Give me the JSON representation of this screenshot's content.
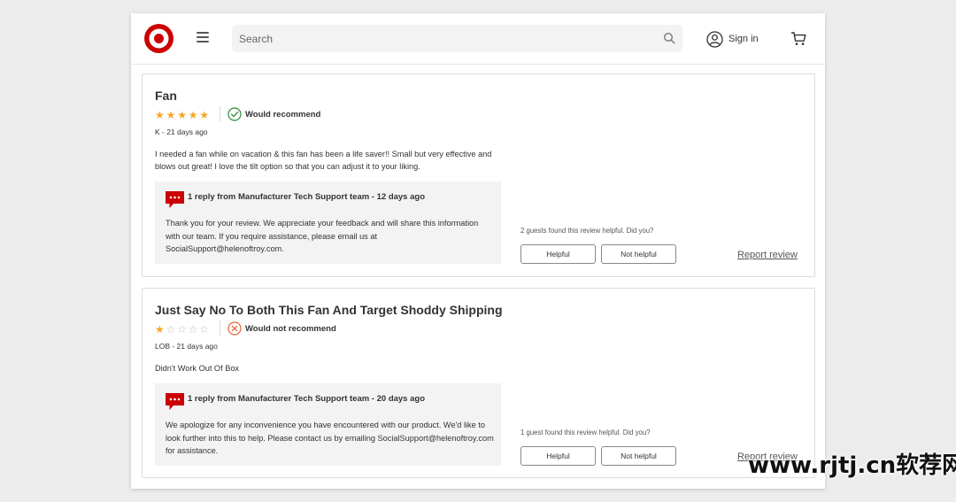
{
  "header": {
    "search_placeholder": "Search",
    "signin_label": "Sign in"
  },
  "reviews": [
    {
      "title": "Fan",
      "rating": 5,
      "stars": [
        "★",
        "★",
        "★",
        "★",
        "★"
      ],
      "recommendation": "Would recommend",
      "meta": "K - 21 days ago",
      "body": "I needed a fan while on vacation & this fan has been a life saver!! Small but very effective and blows out great! I love the tilt option so that you can adjust it to your liking.",
      "reply_heading": "1 reply from Manufacturer Tech Support team - 12 days ago",
      "reply_text": "Thank you for your review. We appreciate your feedback and will share this information with our team. If you require assistance, please email us at SocialSupport@helenoftroy.com.",
      "helpful_question": "2 guests found this review helpful. Did you?",
      "helpful_label": "Helpful",
      "not_helpful_label": "Not helpful",
      "report_label": "Report review"
    },
    {
      "title": "Just Say No To Both This Fan And Target Shoddy Shipping",
      "rating": 1,
      "stars": [
        "★",
        "☆",
        "☆",
        "☆",
        "☆"
      ],
      "recommendation": "Would not recommend",
      "meta": "LOB - 21 days ago",
      "body": "Didn't Work Out Of Box",
      "reply_heading": "1 reply from Manufacturer Tech Support team - 20 days ago",
      "reply_text": "We apologize for any inconvenience you have encountered with our product. We'd like to look further into this to help. Please contact us by emailing SocialSupport@helenoftroy.com for assistance.",
      "helpful_question": "1 guest found this review helpful. Did you?",
      "helpful_label": "Helpful",
      "not_helpful_label": "Not helpful",
      "report_label": "Report review"
    }
  ],
  "watermark": "www.rjtj.cn软荐网",
  "colors": {
    "brand_red": "#cc0000",
    "star_gold": "#f5a623",
    "recommend_green": "#2e8b3a",
    "not_recommend_orange": "#e8663a"
  },
  "icons": [
    "target-logo-icon",
    "menu-icon",
    "search-icon",
    "user-icon",
    "cart-icon",
    "check-circle-icon",
    "x-circle-icon",
    "chat-bubble-icon"
  ]
}
